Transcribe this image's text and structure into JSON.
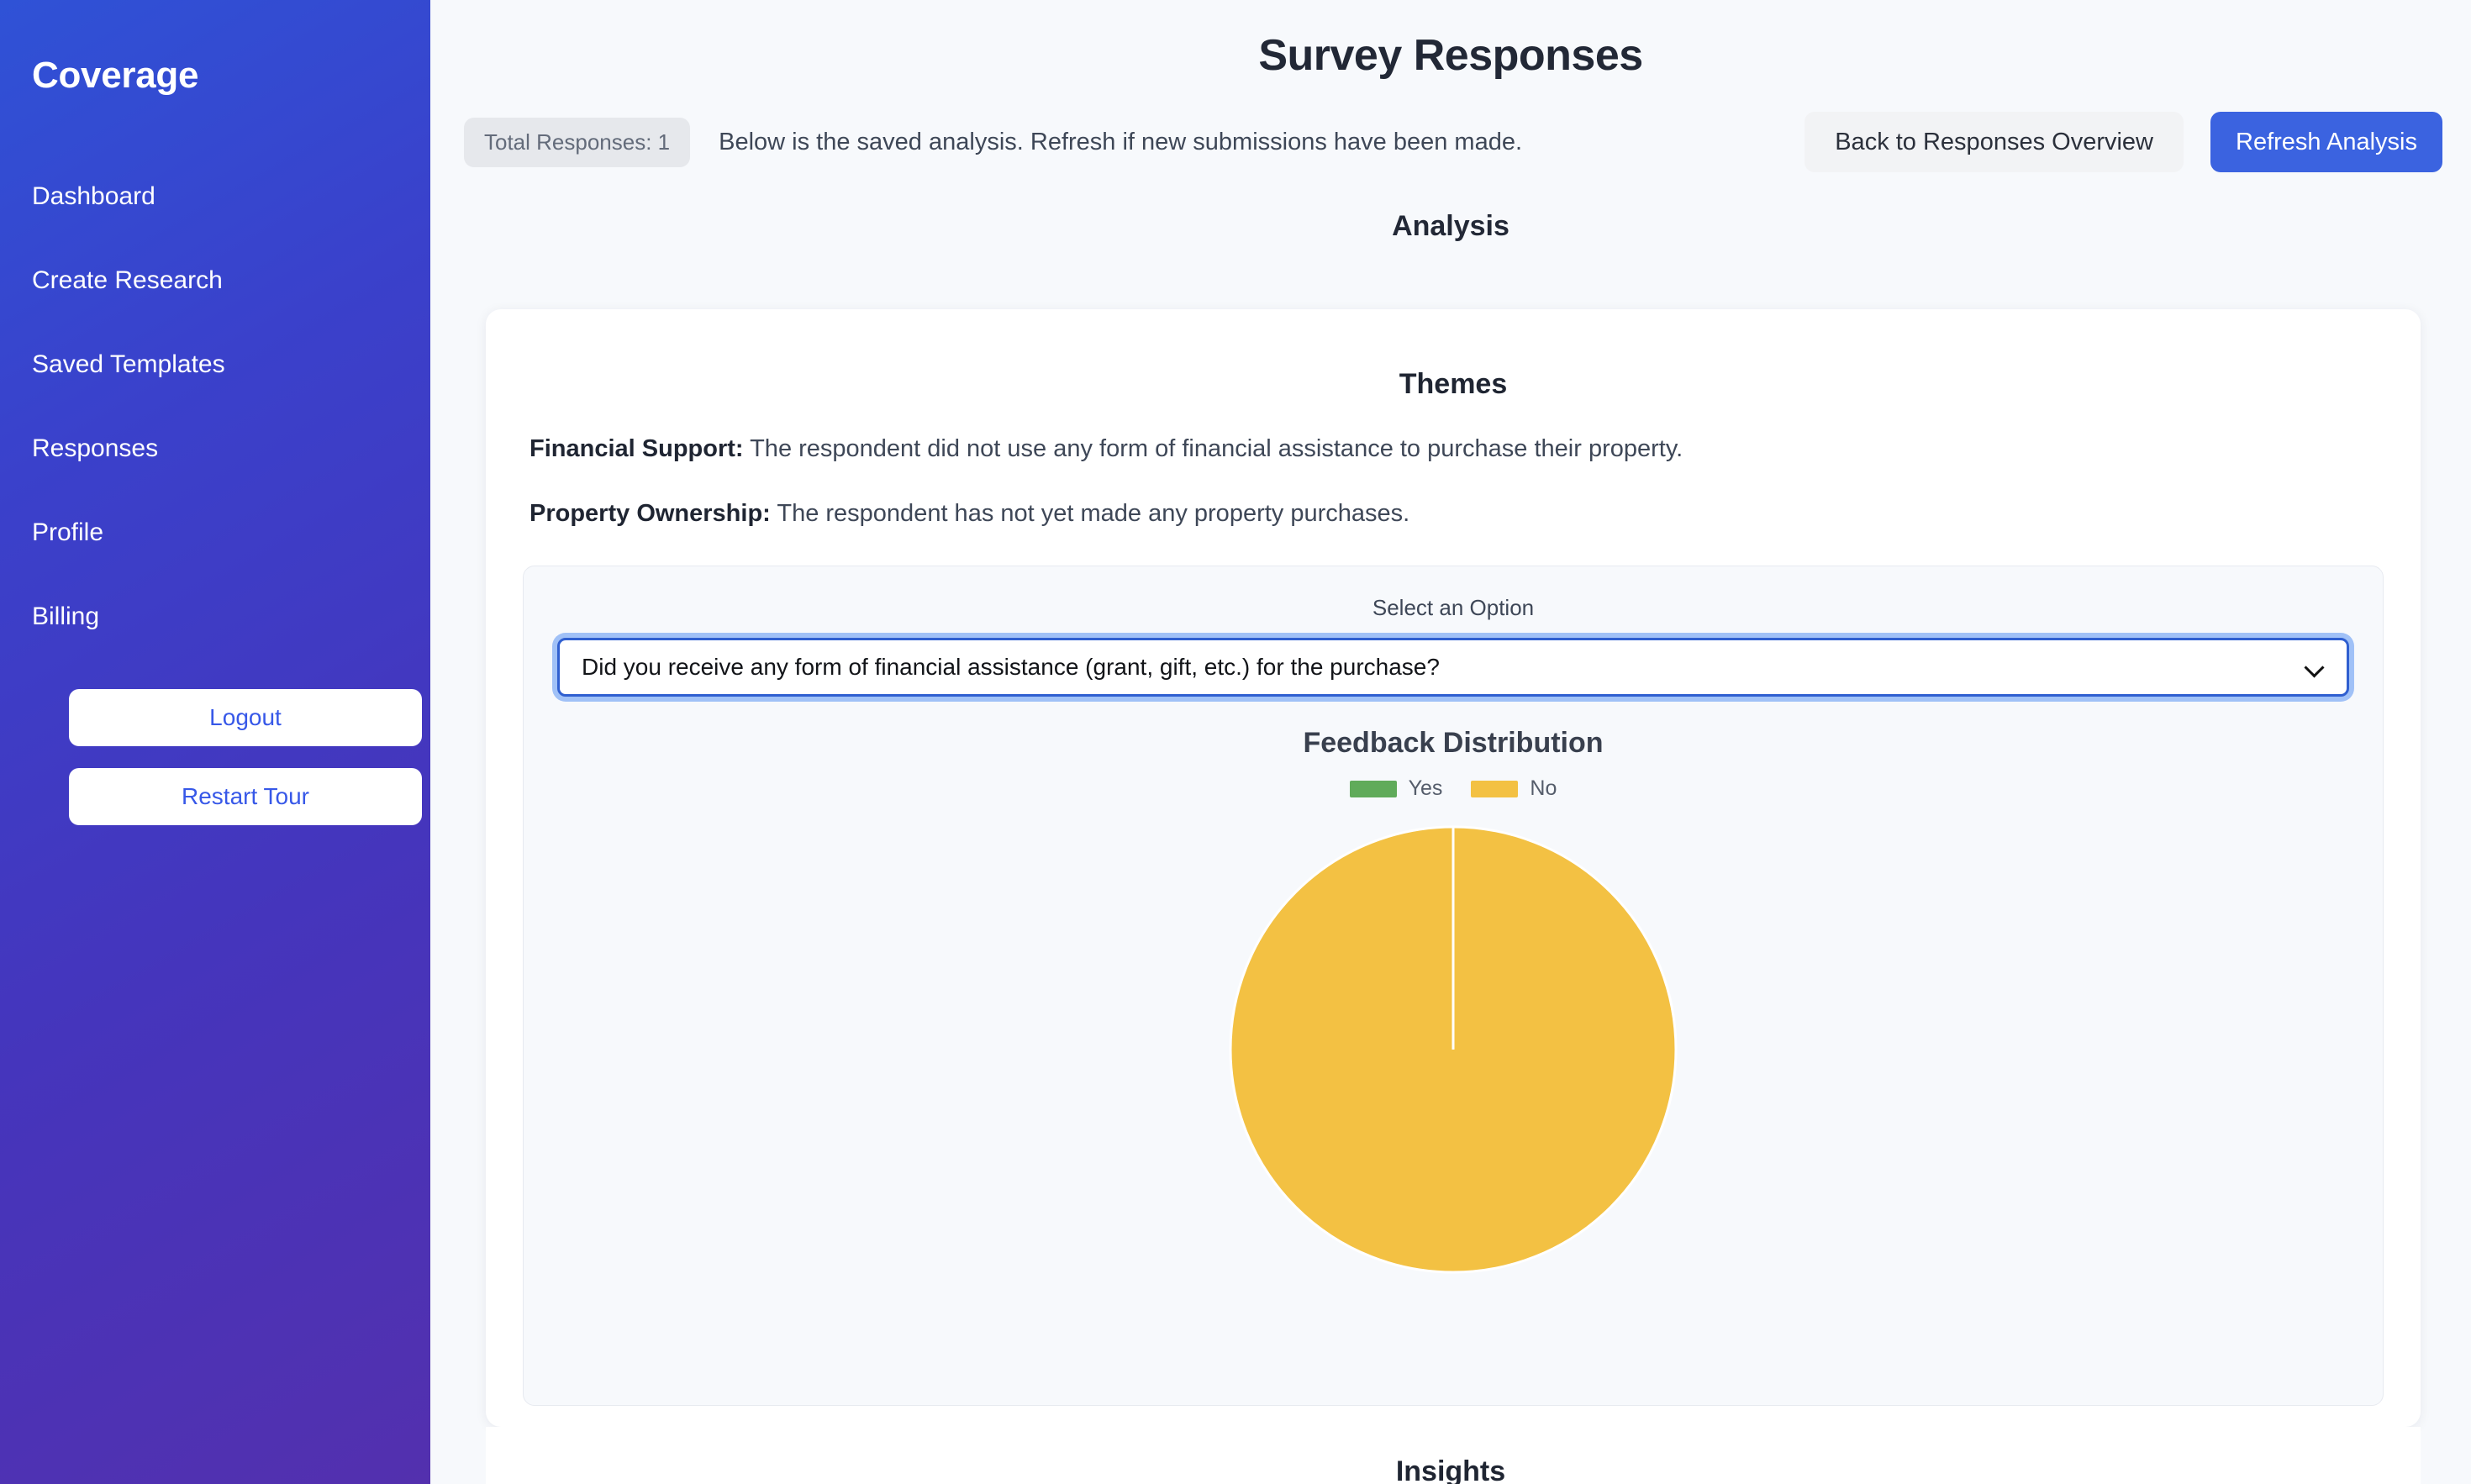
{
  "sidebar": {
    "brand": "Coverage",
    "items": [
      {
        "label": "Dashboard"
      },
      {
        "label": "Create Research"
      },
      {
        "label": "Saved Templates"
      },
      {
        "label": "Responses"
      },
      {
        "label": "Profile"
      },
      {
        "label": "Billing"
      }
    ],
    "logout_label": "Logout",
    "restart_tour_label": "Restart Tour",
    "gradient_start": "#2f52d6",
    "gradient_end": "#5330ae",
    "button_text_color": "#3758e8"
  },
  "header": {
    "title": "Survey Responses",
    "badge": "Total Responses: 1",
    "description": "Below is the saved analysis. Refresh if new submissions have been made.",
    "back_button": "Back to Responses Overview",
    "refresh_button": "Refresh Analysis",
    "primary_color": "#3b63e0"
  },
  "analysis": {
    "section_title": "Analysis",
    "themes_title": "Themes",
    "themes": [
      {
        "label": "Financial Support:",
        "text": " The respondent did not use any form of financial assistance to purchase their property."
      },
      {
        "label": "Property Ownership:",
        "text": " The respondent has not yet made any property purchases."
      }
    ]
  },
  "question_selector": {
    "label": "Select an Option",
    "selected": "Did you receive any form of financial assistance (grant, gift, etc.) for the purchase?",
    "chevron_icon": "chevron-down-icon",
    "focus_ring_color": "#83aef5",
    "border_color": "#2f5fd0"
  },
  "insights": {
    "title": "Insights"
  },
  "chart_data": {
    "type": "pie",
    "title": "Feedback Distribution",
    "categories": [
      "Yes",
      "No"
    ],
    "values": [
      0,
      1
    ],
    "percentages": [
      0,
      100
    ],
    "colors": [
      "#60ab5a",
      "#f3c143"
    ],
    "legend": [
      "Yes",
      "No"
    ],
    "legend_position": "top",
    "start_angle_deg": 0,
    "slice_border_color": "#ffffff"
  }
}
